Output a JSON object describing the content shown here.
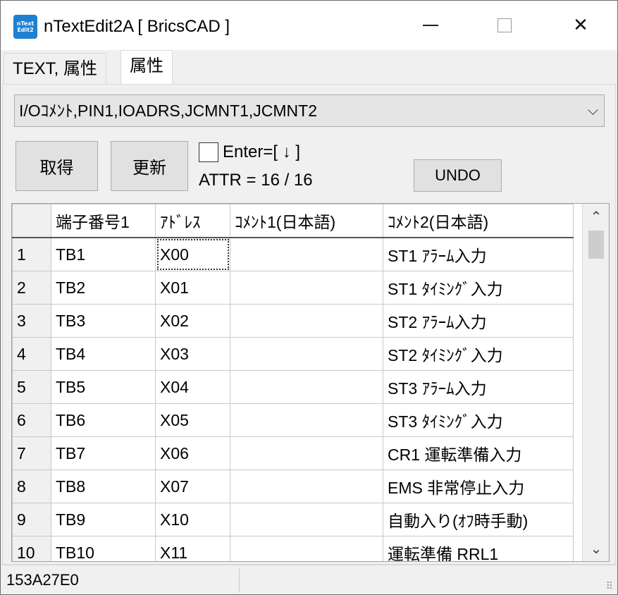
{
  "window": {
    "title": "nTextEdit2A [ BricsCAD ]",
    "icon_text": [
      "nText",
      "Edit2"
    ],
    "icon_name": "app-icon",
    "controls": {
      "minimize": "minimize-icon",
      "maximize": "maximize-icon",
      "close": "✕"
    }
  },
  "tabs": [
    {
      "label": "TEXT, 属性",
      "active": false
    },
    {
      "label": "属性",
      "active": true
    }
  ],
  "combo": {
    "value": "I/Oｺﾒﾝﾄ,PIN1,IOADRS,JCMNT1,JCMNT2",
    "arrow": "⌵"
  },
  "buttons": {
    "get": "取得",
    "update": "更新",
    "undo": "UNDO"
  },
  "enter_option": {
    "label": "Enter=[ ↓ ]",
    "checked": false
  },
  "attr_count": "ATTR = 16 / 16",
  "grid": {
    "headers": [
      "",
      "端子番号1",
      "ｱﾄﾞﾚｽ",
      "ｺﾒﾝﾄ1(日本語)",
      "ｺﾒﾝﾄ2(日本語)"
    ],
    "rows": [
      [
        "1",
        "TB1",
        "X00",
        "",
        "ST1 ｱﾗｰﾑ入力"
      ],
      [
        "2",
        "TB2",
        "X01",
        "",
        "ST1 ﾀｲﾐﾝｸﾞ入力"
      ],
      [
        "3",
        "TB3",
        "X02",
        "",
        "ST2 ｱﾗｰﾑ入力"
      ],
      [
        "4",
        "TB4",
        "X03",
        "",
        "ST2 ﾀｲﾐﾝｸﾞ入力"
      ],
      [
        "5",
        "TB5",
        "X04",
        "",
        "ST3 ｱﾗｰﾑ入力"
      ],
      [
        "6",
        "TB6",
        "X05",
        "",
        "ST3 ﾀｲﾐﾝｸﾞ入力"
      ],
      [
        "7",
        "TB7",
        "X06",
        "",
        "CR1 運転準備入力"
      ],
      [
        "8",
        "TB8",
        "X07",
        "",
        "EMS 非常停止入力"
      ],
      [
        "9",
        "TB9",
        "X10",
        "",
        "自動入り(ｵﾌ時手動)"
      ],
      [
        "10",
        "TB10",
        "X11",
        "",
        "運転準備 RRL1"
      ]
    ],
    "selected_cell": "X00"
  },
  "scrollbar": {
    "up": "⌃",
    "down": "⌄"
  },
  "status": {
    "text": "153A27E0"
  }
}
